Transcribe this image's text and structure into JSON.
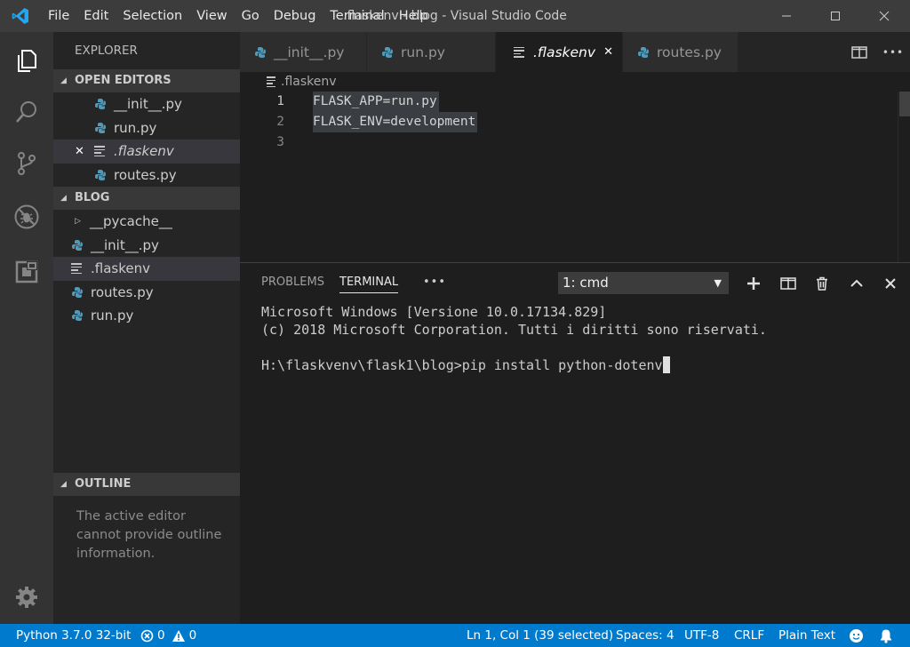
{
  "window": {
    "title": ".flaskenv - blog - Visual Studio Code",
    "menu": [
      "File",
      "Edit",
      "Selection",
      "View",
      "Go",
      "Debug",
      "Terminal",
      "Help"
    ]
  },
  "activity_bar": [
    "explorer-icon",
    "search-icon",
    "source-control-icon",
    "debug-icon",
    "extensions-icon",
    "settings-gear-icon"
  ],
  "sidebar": {
    "title": "EXPLORER",
    "open_editors": {
      "header": "OPEN EDITORS",
      "items": [
        {
          "label": "__init__.py",
          "icon": "python-icon"
        },
        {
          "label": "run.py",
          "icon": "python-icon"
        },
        {
          "label": ".flaskenv",
          "icon": "text-file-icon",
          "active": true,
          "close": "✕"
        },
        {
          "label": "routes.py",
          "icon": "python-icon"
        }
      ]
    },
    "folder": {
      "header": "BLOG",
      "items": [
        {
          "label": "__pycache__",
          "icon": "folder-chevron"
        },
        {
          "label": "__init__.py",
          "icon": "python-icon"
        },
        {
          "label": ".flaskenv",
          "icon": "text-file-icon",
          "active": true
        },
        {
          "label": "routes.py",
          "icon": "python-icon"
        },
        {
          "label": "run.py",
          "icon": "python-icon"
        }
      ]
    },
    "outline": {
      "header": "OUTLINE",
      "message": "The active editor cannot provide outline information."
    }
  },
  "tabs": [
    {
      "label": "__init__.py",
      "icon": "python-icon"
    },
    {
      "label": "run.py",
      "icon": "python-icon"
    },
    {
      "label": ".flaskenv",
      "icon": "text-file-icon",
      "active": true,
      "close": "✕"
    },
    {
      "label": "routes.py",
      "icon": "python-icon"
    }
  ],
  "breadcrumb": ".flaskenv",
  "editor": {
    "lines": [
      {
        "num": "1",
        "text": "FLASK_APP=run.py"
      },
      {
        "num": "2",
        "text": "FLASK_ENV=development"
      },
      {
        "num": "3",
        "text": ""
      }
    ]
  },
  "panel": {
    "tabs": [
      "PROBLEMS",
      "TERMINAL"
    ],
    "more": "•••",
    "terminal_select": "1: cmd",
    "terminal_lines": [
      "Microsoft Windows [Versione 10.0.17134.829]",
      "(c) 2018 Microsoft Corporation. Tutti i diritti sono riservati.",
      "",
      "H:\\flaskvenv\\flask1\\blog>pip install python-dotenv"
    ]
  },
  "statusbar": {
    "python": "Python 3.7.0 32-bit",
    "errors": "0",
    "warnings": "0",
    "position": "Ln 1, Col 1 (39 selected)",
    "spaces": "Spaces: 4",
    "encoding": "UTF-8",
    "eol": "CRLF",
    "language": "Plain Text"
  },
  "colors": {
    "accent": "#007acc",
    "activity_bar": "#333333",
    "sidebar": "#252526",
    "editor": "#1e1e1e",
    "python_icon": "#519aba"
  }
}
